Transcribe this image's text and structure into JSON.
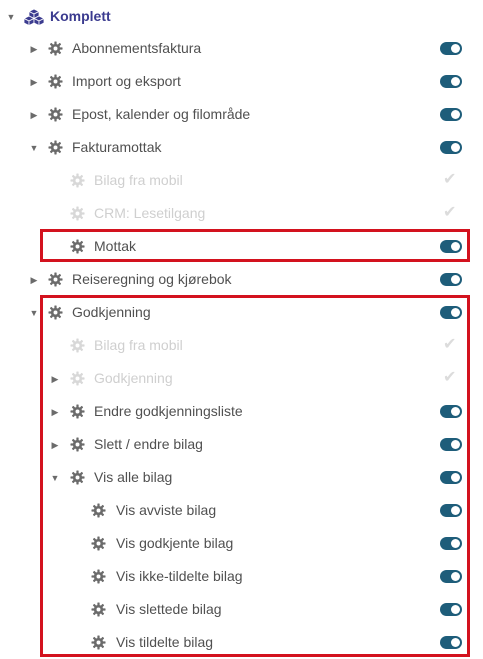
{
  "root": {
    "label": "Komplett",
    "icon": "cubes-icon",
    "expanded": true
  },
  "colors": {
    "toggle_on": "#1e5d7a",
    "highlight": "#d3121e",
    "root_label": "#3b3b8f"
  },
  "items": [
    {
      "label": "Abonnementsfaktura",
      "level": 1,
      "caret": "right",
      "state": "on"
    },
    {
      "label": "Import og eksport",
      "level": 1,
      "caret": "right",
      "state": "on"
    },
    {
      "label": "Epost, kalender og filområde",
      "level": 1,
      "caret": "right",
      "state": "on"
    },
    {
      "label": "Fakturamottak",
      "level": 1,
      "caret": "down",
      "state": "on"
    },
    {
      "label": "Bilag fra mobil",
      "level": 2,
      "caret": "none",
      "state": "check",
      "disabled": true
    },
    {
      "label": "CRM: Lesetilgang",
      "level": 2,
      "caret": "none",
      "state": "check",
      "disabled": true
    },
    {
      "label": "Mottak",
      "level": 2,
      "caret": "none",
      "state": "on"
    },
    {
      "label": "Reiseregning og kjørebok",
      "level": 1,
      "caret": "right",
      "state": "on"
    },
    {
      "label": "Godkjenning",
      "level": 1,
      "caret": "down",
      "state": "on"
    },
    {
      "label": "Bilag fra mobil",
      "level": 2,
      "caret": "none",
      "state": "check",
      "disabled": true
    },
    {
      "label": "Godkjenning",
      "level": 2,
      "caret": "right",
      "state": "check",
      "disabled": true
    },
    {
      "label": "Endre godkjenningsliste",
      "level": 2,
      "caret": "right",
      "state": "on"
    },
    {
      "label": "Slett / endre bilag",
      "level": 2,
      "caret": "right",
      "state": "on"
    },
    {
      "label": "Vis alle bilag",
      "level": 2,
      "caret": "down",
      "state": "on"
    },
    {
      "label": "Vis avviste bilag",
      "level": 3,
      "caret": "none",
      "state": "on"
    },
    {
      "label": "Vis godkjente bilag",
      "level": 3,
      "caret": "none",
      "state": "on"
    },
    {
      "label": "Vis ikke-tildelte bilag",
      "level": 3,
      "caret": "none",
      "state": "on"
    },
    {
      "label": "Vis slettede bilag",
      "level": 3,
      "caret": "none",
      "state": "on"
    },
    {
      "label": "Vis tildelte bilag",
      "level": 3,
      "caret": "none",
      "state": "on"
    }
  ]
}
